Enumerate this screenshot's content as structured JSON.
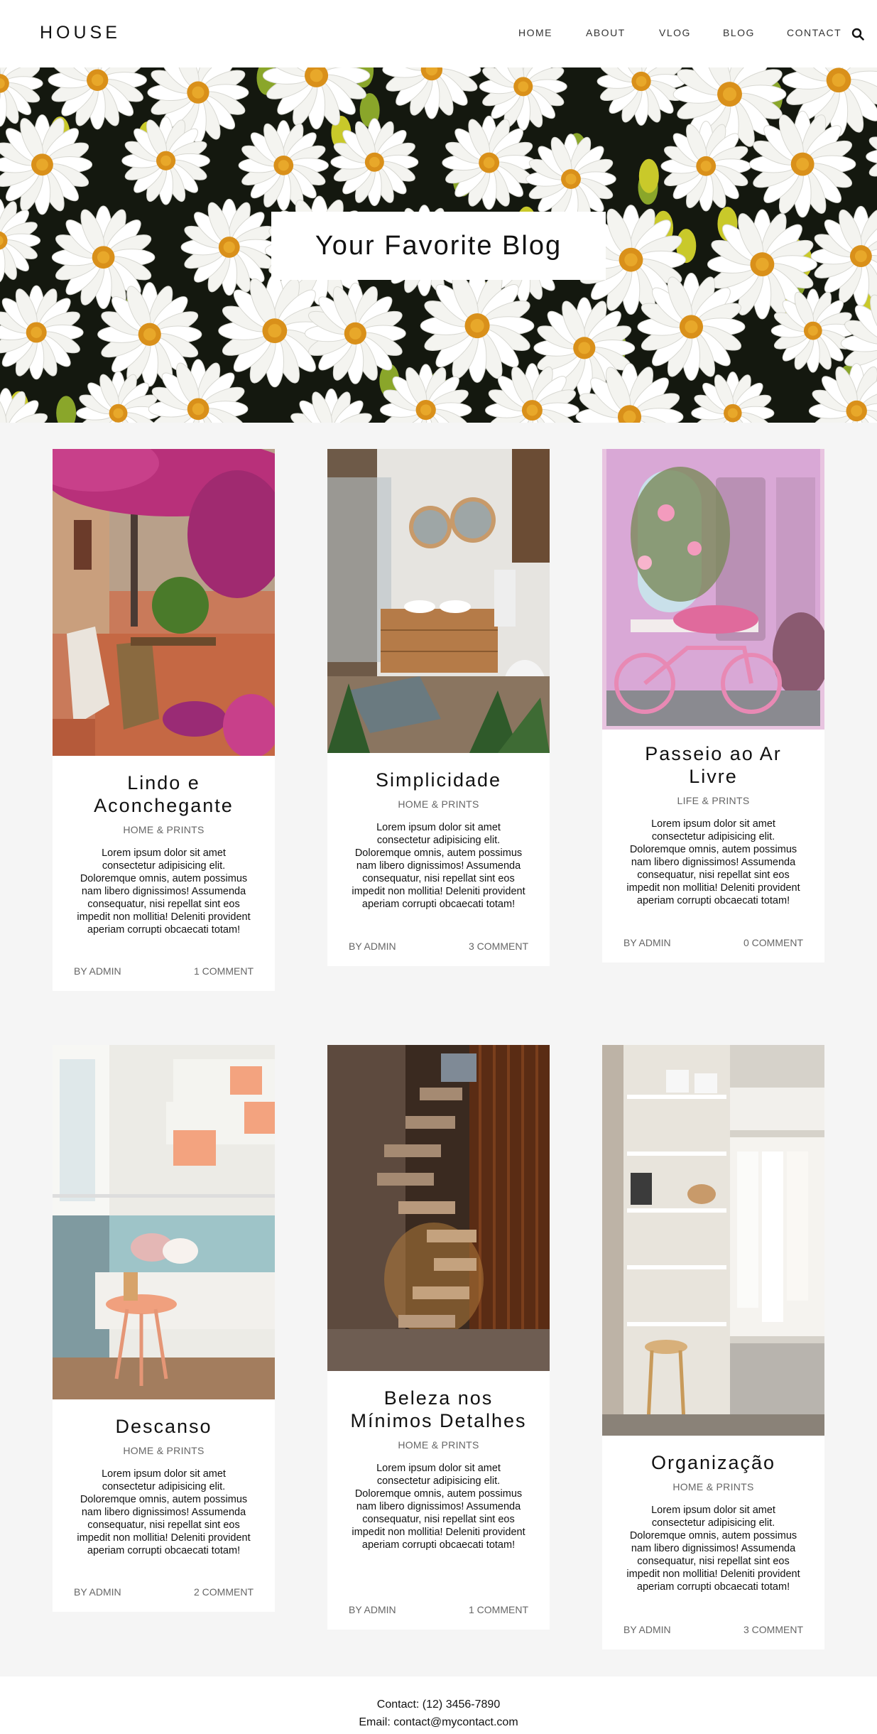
{
  "header": {
    "logo": "HOUSE",
    "nav": [
      "HOME",
      "ABOUT",
      "VLOG",
      "BLOG",
      "CONTACT"
    ]
  },
  "hero": {
    "title": "Your Favorite Blog"
  },
  "posts": [
    {
      "title": "Lindo e Aconchegante",
      "category": "HOME & PRINTS",
      "excerpt": "Lorem ipsum dolor sit amet consectetur adipisicing elit. Doloremque omnis, autem possimus nam libero dignissimos! Assumenda consequatur, nisi repellat sint eos impedit non mollitia! Deleniti provident aperiam corrupti obcaecati totam!",
      "author": "BY ADMIN",
      "comments": "1 COMMENT"
    },
    {
      "title": "Simplicidade",
      "category": "HOME & PRINTS",
      "excerpt": "Lorem ipsum dolor sit amet consectetur adipisicing elit. Doloremque omnis, autem possimus nam libero dignissimos! Assumenda consequatur, nisi repellat sint eos impedit non mollitia! Deleniti provident aperiam corrupti obcaecati totam!",
      "author": "BY ADMIN",
      "comments": "3 COMMENT"
    },
    {
      "title": "Passeio ao Ar Livre",
      "category": "LIFE & PRINTS",
      "excerpt": "Lorem ipsum dolor sit amet consectetur adipisicing elit. Doloremque omnis, autem possimus nam libero dignissimos! Assumenda consequatur, nisi repellat sint eos impedit non mollitia! Deleniti provident aperiam corrupti obcaecati totam!",
      "author": "BY ADMIN",
      "comments": "0 COMMENT"
    },
    {
      "title": "Descanso",
      "category": "HOME & PRINTS",
      "excerpt": "Lorem ipsum dolor sit amet consectetur adipisicing elit. Doloremque omnis, autem possimus nam libero dignissimos! Assumenda consequatur, nisi repellat sint eos impedit non mollitia! Deleniti provident aperiam corrupti obcaecati totam!",
      "author": "BY ADMIN",
      "comments": "2 COMMENT"
    },
    {
      "title": "Beleza nos Mínimos Detalhes",
      "category": "HOME & PRINTS",
      "excerpt": "Lorem ipsum dolor sit amet consectetur adipisicing elit. Doloremque omnis, autem possimus nam libero dignissimos! Assumenda consequatur, nisi repellat sint eos impedit non mollitia! Deleniti provident aperiam corrupti obcaecati totam!",
      "author": "BY ADMIN",
      "comments": "1 COMMENT"
    },
    {
      "title": "Organização",
      "category": "HOME & PRINTS",
      "excerpt": "Lorem ipsum dolor sit amet consectetur adipisicing elit. Doloremque omnis, autem possimus nam libero dignissimos! Assumenda consequatur, nisi repellat sint eos impedit non mollitia! Deleniti provident aperiam corrupti obcaecati totam!",
      "author": "BY ADMIN",
      "comments": "3 COMMENT"
    }
  ],
  "footer": {
    "phone": "Contact: (12) 3456-7890",
    "email": "Email: contact@mycontact.com"
  }
}
